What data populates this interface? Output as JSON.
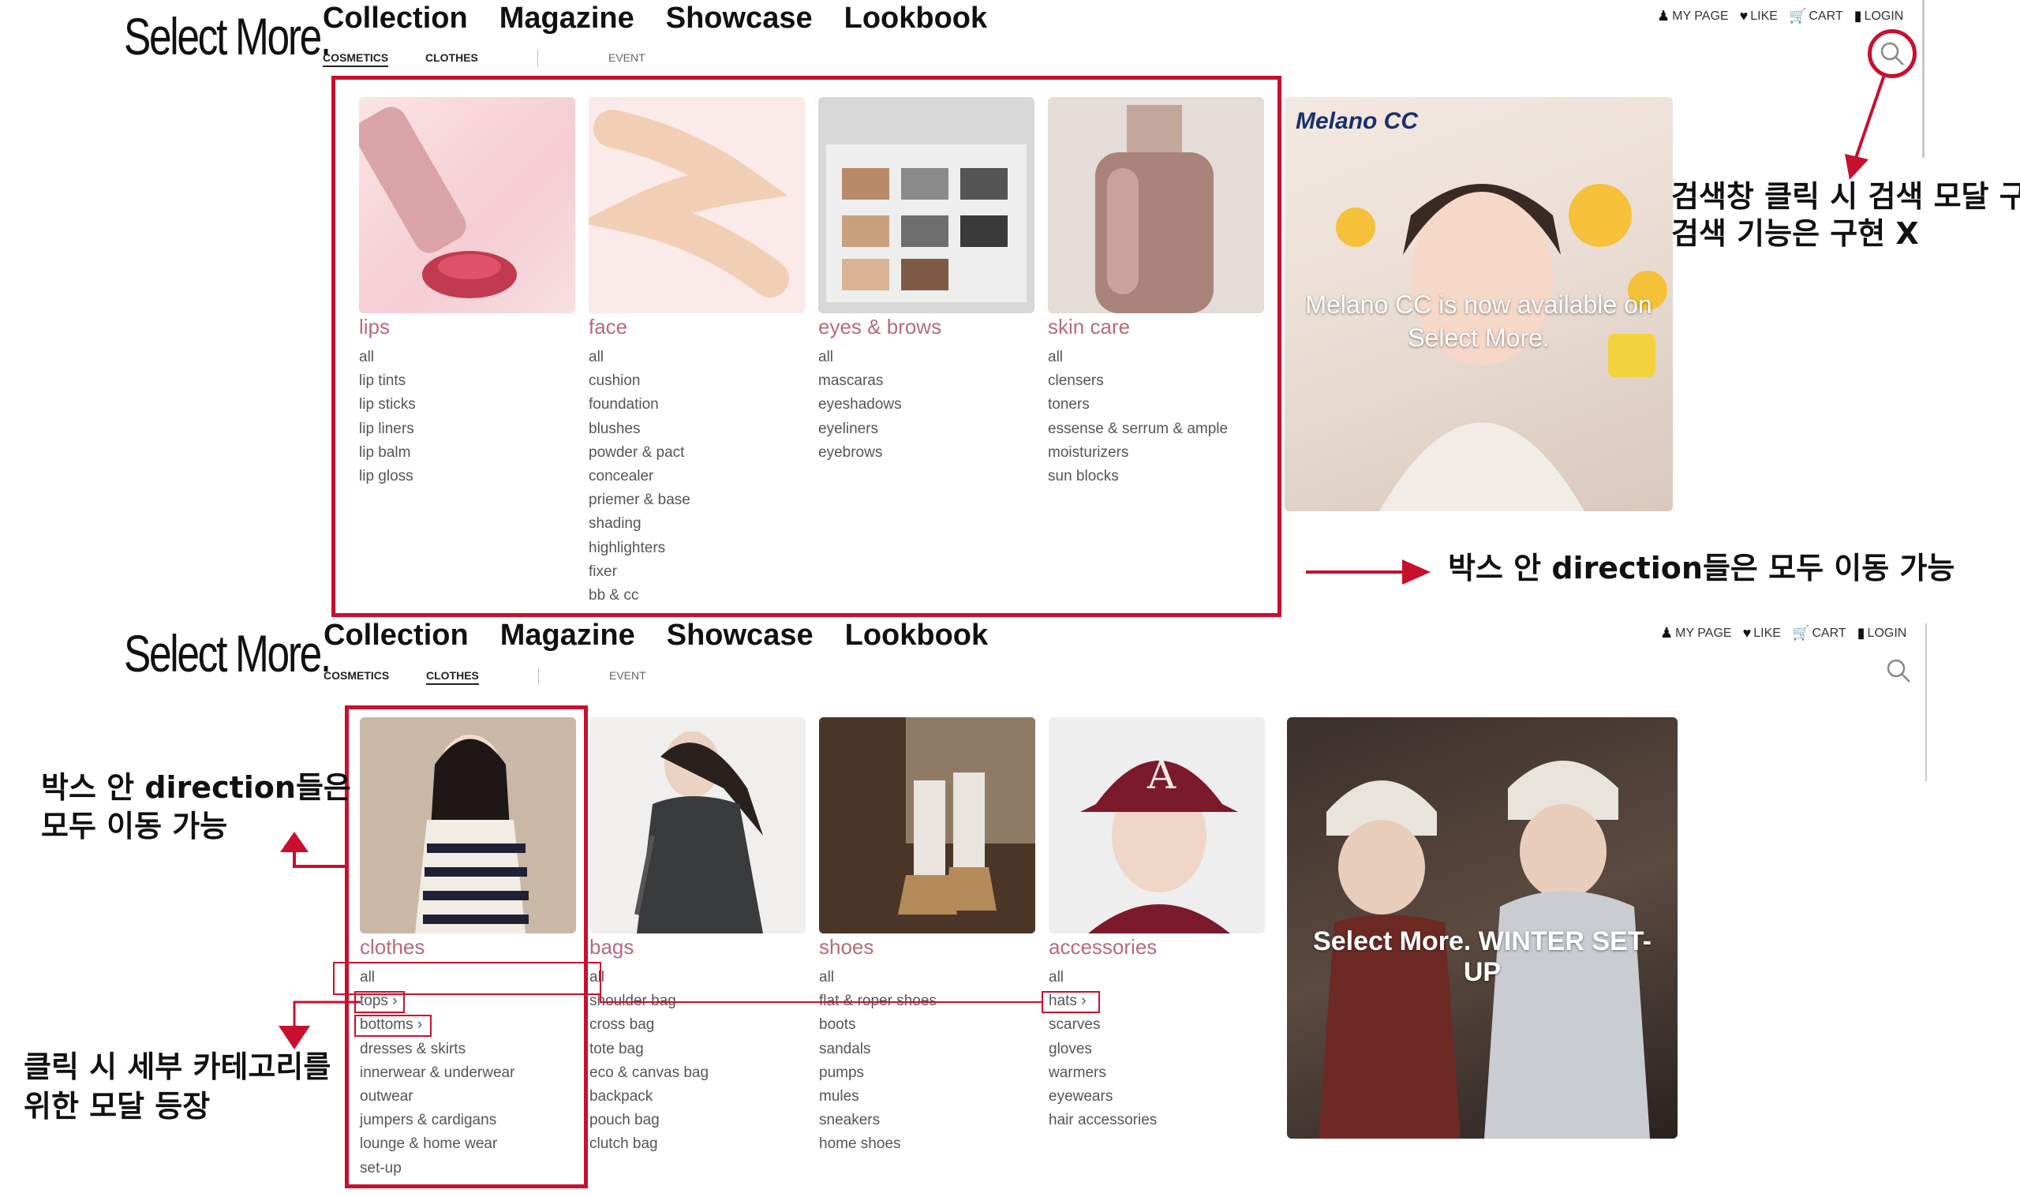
{
  "logo": "Select More.",
  "nav": {
    "main": [
      "Collection",
      "Magazine",
      "Showcase",
      "Lookbook"
    ]
  },
  "subnav": {
    "cosmetics": "COSMETICS",
    "clothes": "CLOTHES",
    "event": "EVENT"
  },
  "util": {
    "mypage": "MY PAGE",
    "like": "LIKE",
    "cart": "CART",
    "login": "LOGIN"
  },
  "cosmetics_menu": [
    {
      "title": "lips",
      "items": [
        "all",
        "lip tints",
        "lip sticks",
        "lip liners",
        "lip balm",
        "lip gloss"
      ]
    },
    {
      "title": "face",
      "items": [
        "all",
        "cushion",
        "foundation",
        "blushes",
        "powder & pact",
        "concealer",
        "priemer & base",
        "shading",
        "highlighters",
        "fixer",
        "bb & cc"
      ]
    },
    {
      "title": "eyes & brows",
      "items": [
        "all",
        "mascaras",
        "eyeshadows",
        "eyeliners",
        "eyebrows"
      ]
    },
    {
      "title": "skin care",
      "items": [
        "all",
        "clensers",
        "toners",
        "essense & serrum & ample",
        "moisturizers",
        "sun blocks"
      ]
    }
  ],
  "clothes_menu": [
    {
      "title": "clothes",
      "items": [
        "all",
        "tops ›",
        "bottoms ›",
        "dresses & skirts",
        "innerwear & underwear",
        "outwear",
        "jumpers & cardigans",
        "lounge & home wear",
        "set-up"
      ]
    },
    {
      "title": "bags",
      "items": [
        "all",
        "shoulder bag",
        "cross bag",
        "tote bag",
        "eco & canvas bag",
        "backpack",
        "pouch bag",
        "clutch bag"
      ]
    },
    {
      "title": "shoes",
      "items": [
        "all",
        "flat & roper shoes",
        "boots",
        "sandals",
        "pumps",
        "mules",
        "sneakers",
        "home shoes"
      ]
    },
    {
      "title": "accessories",
      "items": [
        "all",
        "hats ›",
        "scarves",
        "gloves",
        "warmers",
        "eyewears",
        "hair accessories"
      ]
    }
  ],
  "banner1": {
    "brand": "Melano CC",
    "text": "Melano CC is now available on Select More."
  },
  "banner2": {
    "text": "Select More. WINTER SET-UP"
  },
  "annotations": {
    "search_line1": "검색창 클릭 시 검색 모달 구현",
    "search_line2": "검색 기능은 구현 X",
    "box_direction": "박스 안 direction들은 모두 이동 가능",
    "left_line1": "박스 안 direction들은",
    "left_line2": "모두 이동 가능",
    "modal_line1": "클릭 시 세부 카테고리를",
    "modal_line2": "위한 모달 등장"
  },
  "colors": {
    "accent": "#c8102e",
    "category": "#b96a7a"
  }
}
